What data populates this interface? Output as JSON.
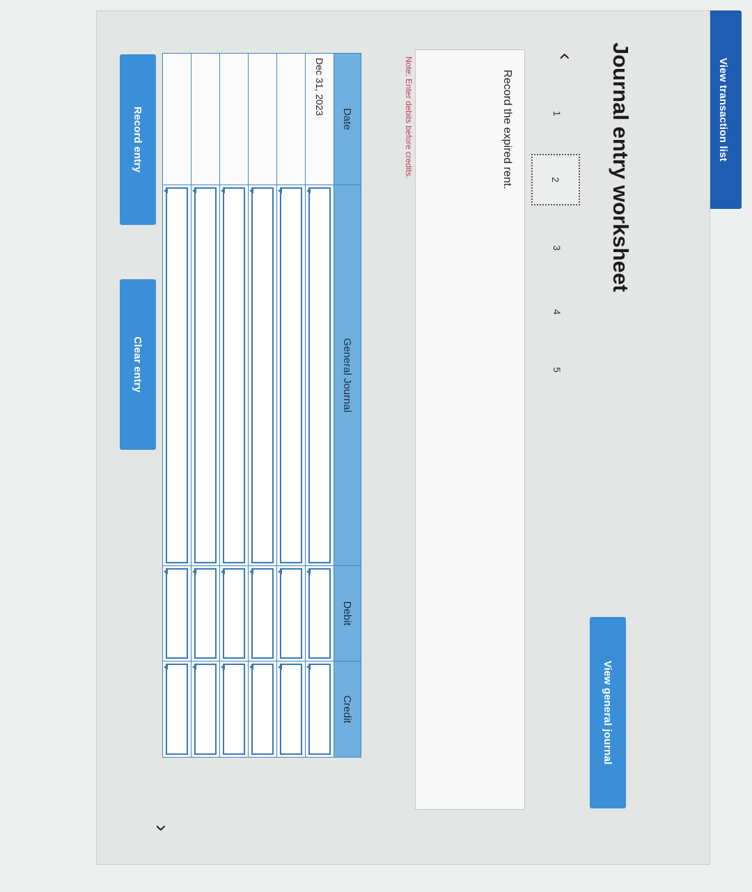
{
  "header": {
    "view_transaction_list": "View transaction list"
  },
  "title": "Journal entry worksheet",
  "pager": {
    "pages": [
      "1",
      "2",
      "3",
      "4",
      "5"
    ],
    "active_page": "2"
  },
  "instruction": "Record the expired rent.",
  "note": "Note: Enter debits before credits.",
  "journal": {
    "columns": [
      "Date",
      "General Journal",
      "Debit",
      "Credit"
    ],
    "rows": [
      {
        "date": "Dec 31, 2023",
        "account": "",
        "debit": "",
        "credit": ""
      },
      {
        "date": "",
        "account": "",
        "debit": "",
        "credit": ""
      },
      {
        "date": "",
        "account": "",
        "debit": "",
        "credit": ""
      },
      {
        "date": "",
        "account": "",
        "debit": "",
        "credit": ""
      },
      {
        "date": "",
        "account": "",
        "debit": "",
        "credit": ""
      },
      {
        "date": "",
        "account": "",
        "debit": "",
        "credit": ""
      }
    ]
  },
  "buttons": {
    "record": "Record entry",
    "clear": "Clear entry",
    "view_general_journal": "View general journal"
  },
  "colors": {
    "primary_dark": "#1f5db3",
    "primary": "#3b8fd6",
    "header_bg": "#6fb0e0",
    "note": "#c23b59"
  }
}
